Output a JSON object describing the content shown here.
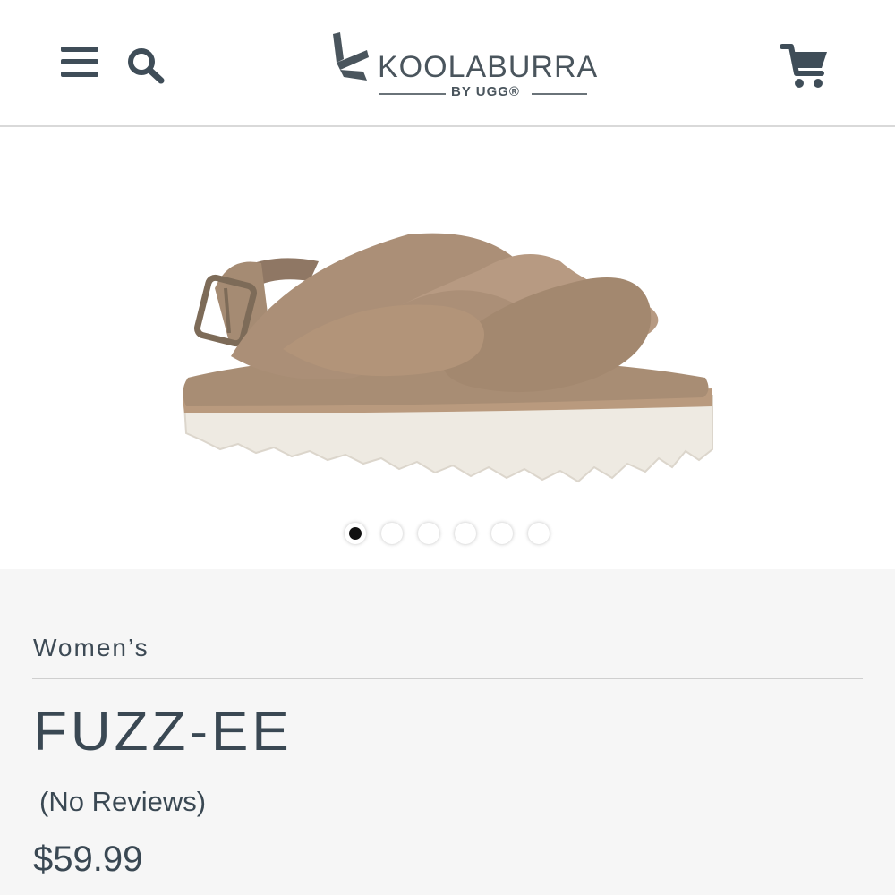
{
  "header": {
    "menu_icon": "hamburger-menu-icon",
    "search_icon": "search-icon",
    "cart_icon": "shopping-cart-icon",
    "logo": {
      "wordmark": "KOOLABURRA",
      "sub": "BY UGG®"
    }
  },
  "gallery": {
    "image": "fuzzy-sandal-product-photo",
    "dots_total": 6,
    "active_dot": 1
  },
  "product": {
    "category": "Women’s",
    "name": "FUZZ-EE",
    "reviews": "(No Reviews)",
    "price": "$59.99"
  },
  "colors": {
    "text": "#3a4853",
    "icon": "#3f4d58",
    "info_bg": "#f6f6f6"
  }
}
